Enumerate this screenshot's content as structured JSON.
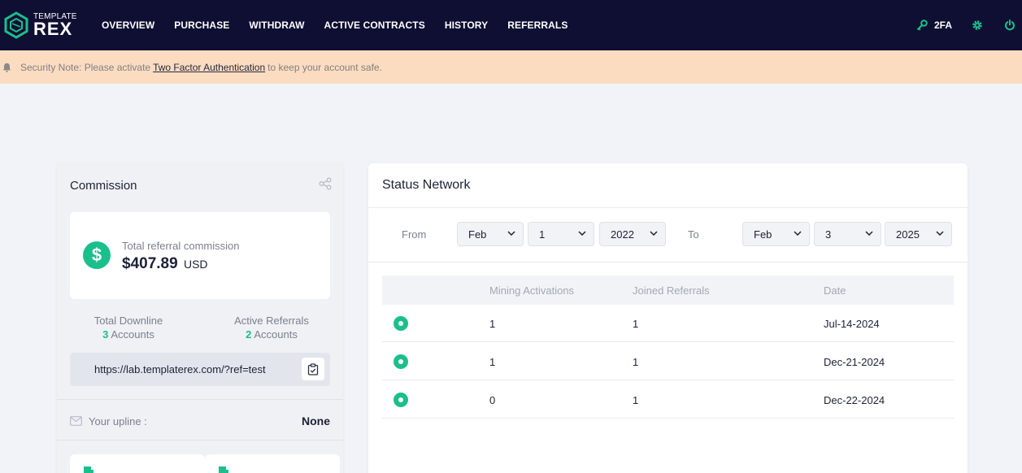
{
  "brand": {
    "small": "TEMPLATE",
    "big": "REX"
  },
  "nav": {
    "items": [
      "OVERVIEW",
      "PURCHASE",
      "WITHDRAW",
      "ACTIVE CONTRACTS",
      "HISTORY",
      "REFERRALS"
    ],
    "twofa_label": "2FA"
  },
  "security": {
    "prefix": "Security Note: Please activate",
    "link": "Two Factor Authentication",
    "suffix": "to keep your account safe."
  },
  "commission": {
    "title": "Commission",
    "total_label": "Total referral commission",
    "total_value": "$407.89",
    "currency": "USD",
    "downline_label": "Total Downline",
    "downline_count": "3",
    "downline_unit": "Accounts",
    "active_label": "Active Referrals",
    "active_count": "2",
    "active_unit": "Accounts",
    "ref_url": "https://lab.templaterex.com/?ref=test",
    "upline_label": "Your upline :",
    "upline_value": "None"
  },
  "status": {
    "title": "Status Network",
    "from_label": "From",
    "to_label": "To",
    "from": {
      "month": "Feb",
      "day": "1",
      "year": "2022"
    },
    "to": {
      "month": "Feb",
      "day": "3",
      "year": "2025"
    },
    "columns": [
      "Mining Activations",
      "Joined Referrals",
      "Date"
    ],
    "rows": [
      {
        "mining": "1",
        "joined": "1",
        "date": "Jul-14-2024"
      },
      {
        "mining": "1",
        "joined": "1",
        "date": "Dec-21-2024"
      },
      {
        "mining": "0",
        "joined": "1",
        "date": "Dec-22-2024"
      }
    ]
  },
  "colors": {
    "accent": "#1bbf8b",
    "navbar": "#0f0f33",
    "alert_bg": "#fcdcc1"
  },
  "icons": [
    "hex-logo-icon",
    "key-icon",
    "gear-icon",
    "power-icon",
    "bell-icon",
    "share-icon",
    "dollar-icon",
    "clipboard-icon",
    "mail-icon",
    "chevron-down-icon",
    "status-dot-icon"
  ]
}
